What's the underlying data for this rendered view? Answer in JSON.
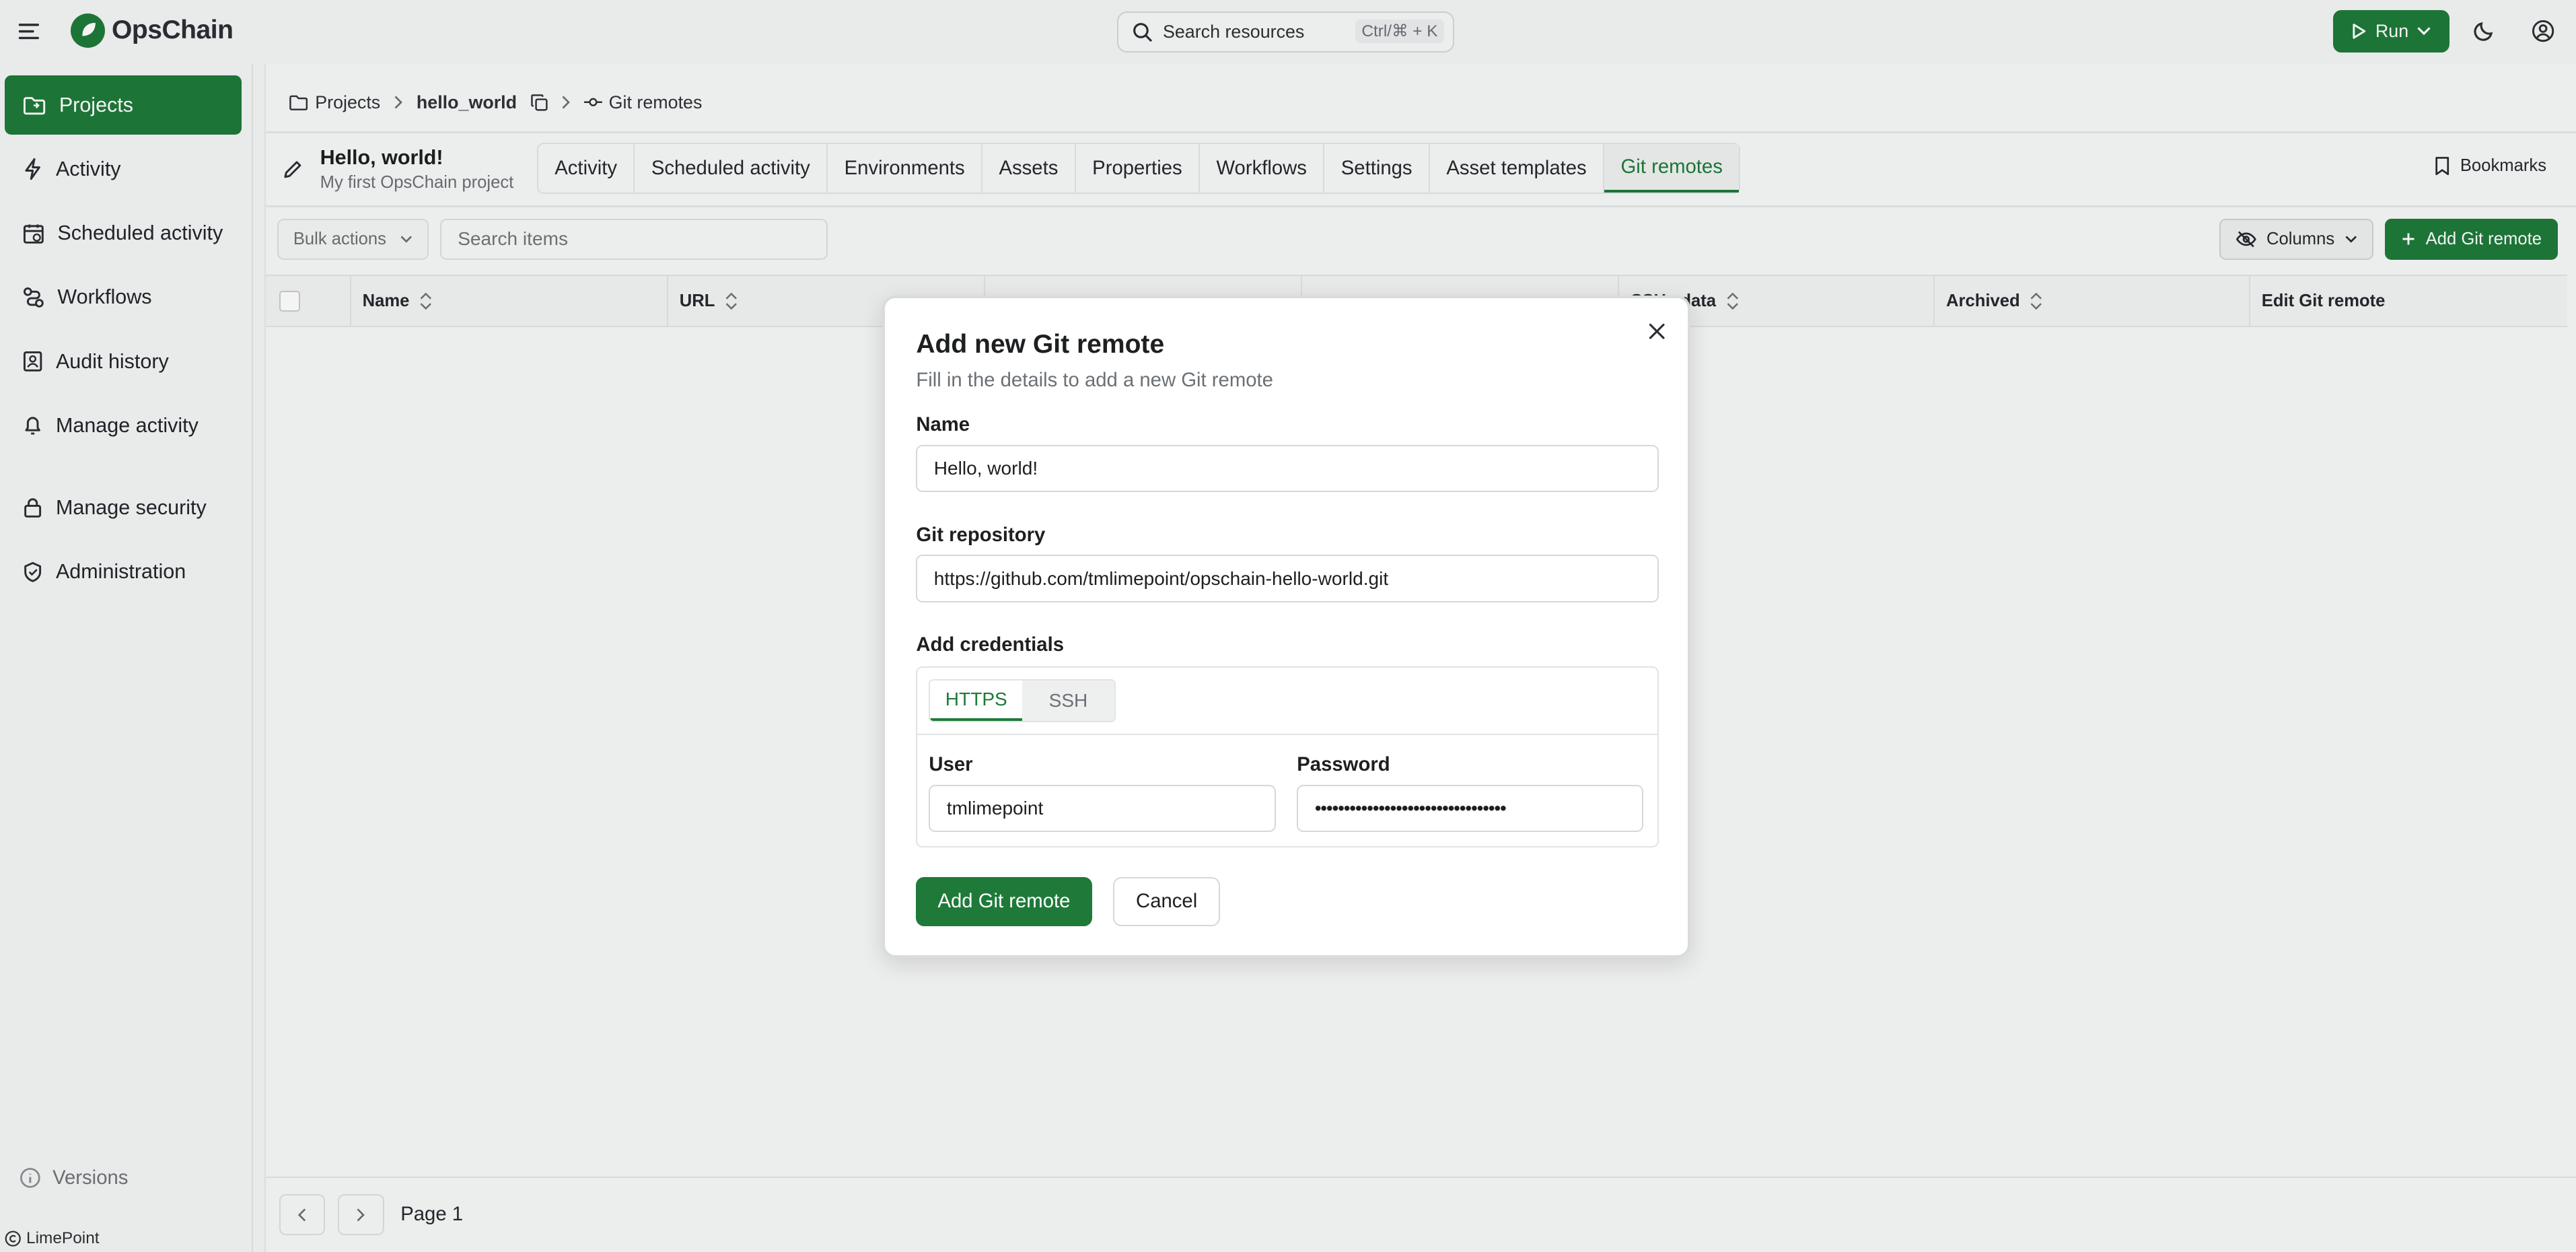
{
  "app": {
    "name": "OpsChain",
    "search_label": "Search resources",
    "search_shortcut": "Ctrl/⌘ + K",
    "run_label": "Run"
  },
  "sidebar": {
    "items": [
      {
        "label": "Projects",
        "icon": "folder-icon"
      },
      {
        "label": "Activity",
        "icon": "bolt-icon"
      },
      {
        "label": "Scheduled activity",
        "icon": "calendar-icon"
      },
      {
        "label": "Workflows",
        "icon": "workflow-icon"
      },
      {
        "label": "Audit history",
        "icon": "audit-icon"
      },
      {
        "label": "Manage activity",
        "icon": "bell-icon"
      },
      {
        "label": "Manage security",
        "icon": "lock-icon"
      },
      {
        "label": "Administration",
        "icon": "shield-icon"
      }
    ],
    "versions_label": "Versions",
    "footer_label": "LimePoint"
  },
  "breadcrumb": {
    "root": "Projects",
    "project": "hello_world",
    "current": "Git remotes"
  },
  "project": {
    "name": "Hello, world!",
    "description": "My first OpsChain project"
  },
  "tabs": [
    "Activity",
    "Scheduled activity",
    "Environments",
    "Assets",
    "Properties",
    "Workflows",
    "Settings",
    "Asset templates",
    "Git remotes"
  ],
  "bookmarks_label": "Bookmarks",
  "toolbar": {
    "bulk_actions": "Bulk actions",
    "search_placeholder": "Search items",
    "columns": "Columns",
    "add_button": "Add Git remote"
  },
  "table": {
    "columns": [
      "Name",
      "URL",
      "",
      "",
      "SSH   data",
      "Archived",
      "Edit Git remote"
    ]
  },
  "pagination": {
    "page_label": "Page 1"
  },
  "modal": {
    "title": "Add new Git remote",
    "subtitle": "Fill in the details to add a new Git remote",
    "name_label": "Name",
    "name_value": "Hello, world!",
    "repo_label": "Git repository",
    "repo_value": "https://github.com/tmlimepoint/opschain-hello-world.git",
    "credentials_label": "Add credentials",
    "cred_tabs": [
      "HTTPS",
      "SSH"
    ],
    "user_label": "User",
    "user_value": "tmlimepoint",
    "password_label": "Password",
    "password_value": "•••••••••••••••••••••••••••••••••",
    "submit": "Add Git remote",
    "cancel": "Cancel"
  }
}
